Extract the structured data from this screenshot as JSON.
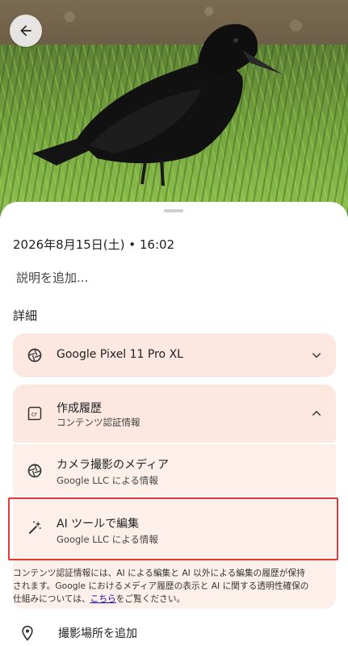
{
  "header": {
    "back_icon": "arrow-left-icon"
  },
  "info": {
    "datetime": "2026年8月15日(土) • 16:02",
    "description_placeholder": "説明を追加...",
    "details_label": "詳細"
  },
  "device": {
    "name": "Google Pixel 11 Pro XL",
    "icon": "camera-shutter-icon"
  },
  "history": {
    "title": "作成履歴",
    "subtitle": "コンテンツ認証情報",
    "icon": "content-credentials-icon"
  },
  "history_items": [
    {
      "title": "カメラ撮影のメディア",
      "subtitle": "Google LLC による情報",
      "icon": "camera-shutter-icon"
    },
    {
      "title": "AI ツールで編集",
      "subtitle": "Google LLC による情報",
      "icon": "magic-wand-icon"
    }
  ],
  "note": {
    "text": "コンテンツ認証情報には、AI による編集と AI 以外による編集の履歴が保持されます。Google におけるメディア履歴の表示と AI に関する透明性確保の仕組みについては、",
    "link": "こちら",
    "suffix": "をご覧ください。"
  },
  "location": {
    "label": "撮影場所を追加",
    "icon": "location-pin-icon"
  },
  "colors": {
    "card_bg": "#fce8e0",
    "card_sub_bg": "#fdf0ea",
    "highlight": "#e53935"
  }
}
